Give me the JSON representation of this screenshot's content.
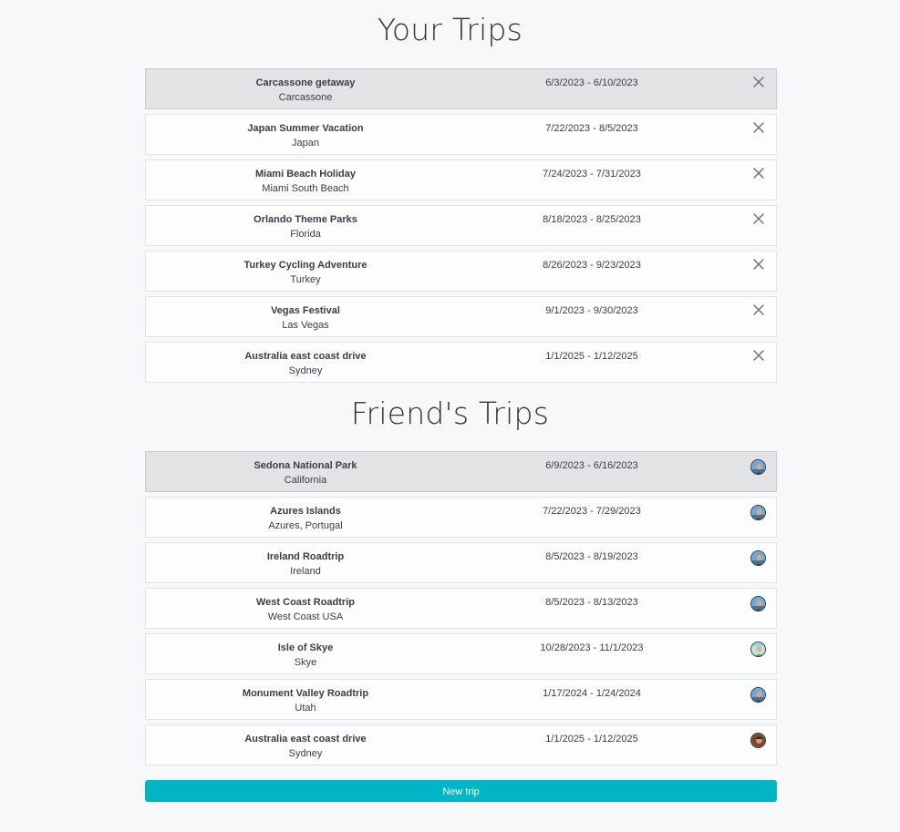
{
  "your_trips": {
    "title": "Your Trips",
    "items": [
      {
        "name": "Carcassone getaway",
        "place": "Carcassone",
        "dates": "6/3/2023 - 6/10/2023",
        "selected": true
      },
      {
        "name": "Japan Summer Vacation",
        "place": "Japan",
        "dates": "7/22/2023 - 8/5/2023",
        "selected": false
      },
      {
        "name": "Miami Beach Holiday",
        "place": "Miami South Beach",
        "dates": "7/24/2023 - 7/31/2023",
        "selected": false
      },
      {
        "name": "Orlando Theme Parks",
        "place": "Florida",
        "dates": "8/18/2023 - 8/25/2023",
        "selected": false
      },
      {
        "name": "Turkey Cycling Adventure",
        "place": "Turkey",
        "dates": "8/26/2023 - 9/23/2023",
        "selected": false
      },
      {
        "name": "Vegas Festival",
        "place": "Las Vegas",
        "dates": "9/1/2023 - 9/30/2023",
        "selected": false
      },
      {
        "name": "Australia east coast drive",
        "place": "Sydney",
        "dates": "1/1/2025 - 1/12/2025",
        "selected": false
      }
    ],
    "action_icon": "close-icon"
  },
  "friends_trips": {
    "title": "Friend's Trips",
    "items": [
      {
        "name": "Sedona National Park",
        "place": "California",
        "dates": "6/9/2023 - 6/16/2023",
        "avatar": "avatar-a",
        "selected": true
      },
      {
        "name": "Azures Islands",
        "place": "Azures, Portugal",
        "dates": "7/22/2023 - 7/29/2023",
        "avatar": "avatar-a",
        "selected": false
      },
      {
        "name": "Ireland Roadtrip",
        "place": "Ireland",
        "dates": "8/5/2023 - 8/19/2023",
        "avatar": "avatar-a",
        "selected": false
      },
      {
        "name": "West Coast Roadtrip",
        "place": "West Coast USA",
        "dates": "8/5/2023 - 8/13/2023",
        "avatar": "avatar-a",
        "selected": false
      },
      {
        "name": "Isle of Skye",
        "place": "Skye",
        "dates": "10/28/2023 - 11/1/2023",
        "avatar": "avatar-b",
        "selected": false
      },
      {
        "name": "Monument Valley Roadtrip",
        "place": "Utah",
        "dates": "1/17/2024 - 1/24/2024",
        "avatar": "avatar-a",
        "selected": false
      },
      {
        "name": "Australia east coast drive",
        "place": "Sydney",
        "dates": "1/1/2025 - 1/12/2025",
        "avatar": "avatar-c",
        "selected": false
      }
    ]
  },
  "new_trip_button": {
    "label": "New trip"
  },
  "colors": {
    "accent": "#00b5c4",
    "selected_row": "#e2e3e5",
    "background": "#f7f8fa"
  }
}
